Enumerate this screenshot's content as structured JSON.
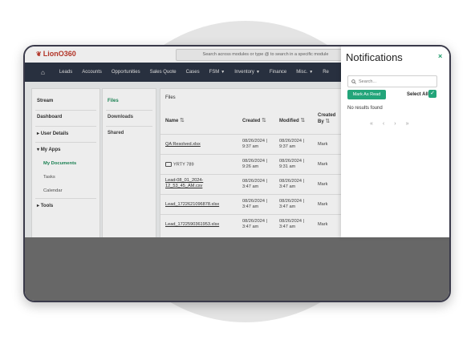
{
  "app": {
    "logo_text": "LionO360",
    "search_placeholder": "Search across modules or type @ to search in a specific module"
  },
  "nav": {
    "items": [
      {
        "label": "Leads"
      },
      {
        "label": "Accounts"
      },
      {
        "label": "Opportunities"
      },
      {
        "label": "Sales Quote"
      },
      {
        "label": "Cases"
      },
      {
        "label": "FSM"
      },
      {
        "label": "Inventory"
      },
      {
        "label": "Finance"
      },
      {
        "label": "Misc."
      },
      {
        "label": "Re"
      }
    ]
  },
  "sidebar": {
    "stream": "Stream",
    "dashboard": "Dashboard",
    "user_details": "User Details",
    "my_apps": "My Apps",
    "my_documents": "My Documents",
    "tasks": "Tasks",
    "calendar": "Calendar",
    "tools": "Tools"
  },
  "files_nav": {
    "files": "Files",
    "downloads": "Downloads",
    "shared": "Shared"
  },
  "files_panel": {
    "title": "Files",
    "columns": {
      "name": "Name",
      "created": "Created",
      "modified": "Modified",
      "created_by_1": "Created",
      "created_by_2": "By"
    },
    "rows": [
      {
        "name1": "QA Resolved.xlsx",
        "name2": "",
        "created1": "08/26/2024 |",
        "created2": "9:37 am",
        "modified1": "08/26/2024 |",
        "modified2": "9:37 am",
        "by": "Mark"
      },
      {
        "name1": "YRTY 789",
        "name2": "",
        "created1": "08/26/2024 |",
        "created2": "9:26 am",
        "modified1": "08/26/2024 |",
        "modified2": "9:31 am",
        "by": "Mark"
      },
      {
        "name1": "Lead-08_01_2024-",
        "name2": "12_53_45_AM.csv",
        "created1": "08/26/2024 |",
        "created2": "3:47 am",
        "modified1": "08/26/2024 |",
        "modified2": "3:47 am",
        "by": "Mark"
      },
      {
        "name1": "Lead_1722621096878.xlsx",
        "name2": "",
        "created1": "08/26/2024 |",
        "created2": "3:47 am",
        "modified1": "08/26/2024 |",
        "modified2": "3:47 am",
        "by": "Mark"
      },
      {
        "name1": "Lead_1722590361953.xlsx",
        "name2": "",
        "created1": "08/26/2024 |",
        "created2": "3:47 am",
        "modified1": "08/26/2024 |",
        "modified2": "3:47 am",
        "by": "Mark"
      }
    ]
  },
  "notifications": {
    "title": "Notifications",
    "close": "×",
    "search_placeholder": "Search...",
    "mark_read": "Mark As Read",
    "select_all": "Select All",
    "empty": "No results found",
    "pager": {
      "first": "«",
      "prev": "‹",
      "next": "›",
      "last": "»"
    }
  },
  "colors": {
    "accent": "#23a57a",
    "navbar": "#2c3444",
    "logo": "#c0392b"
  },
  "icons": {
    "home": "home-icon",
    "search": "search-icon",
    "folder": "folder-icon",
    "check": "check-icon"
  }
}
